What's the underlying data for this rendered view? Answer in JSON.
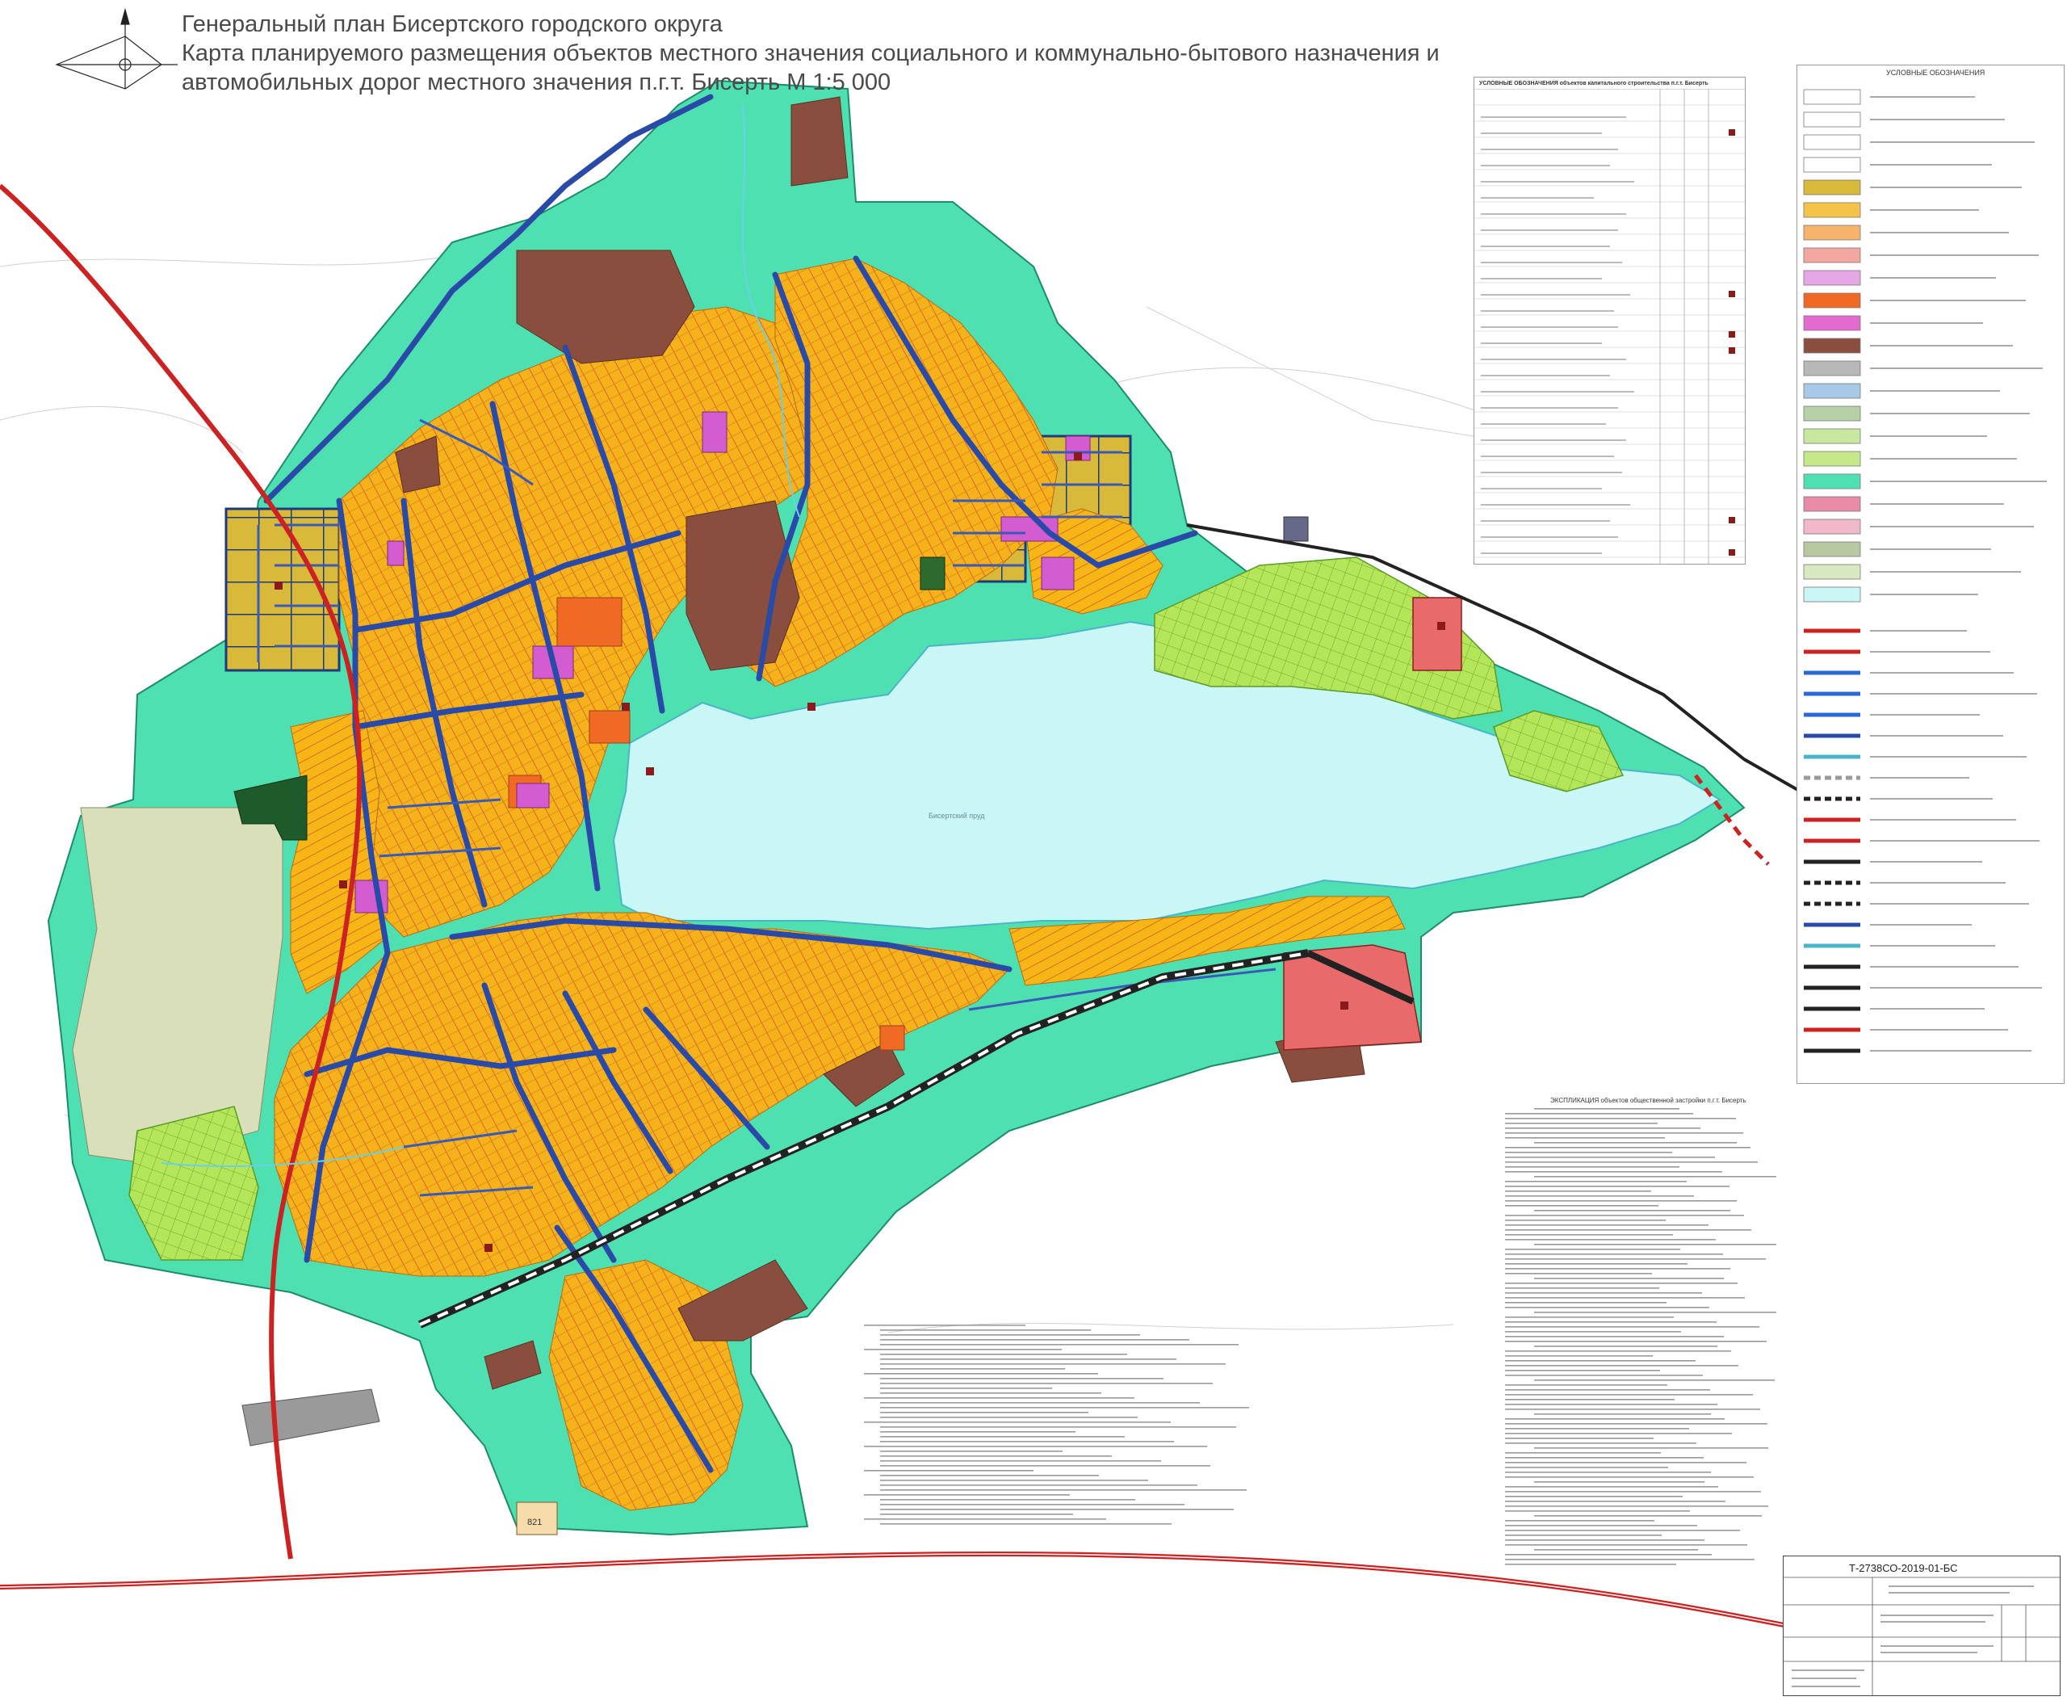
{
  "title": {
    "line1": "Генеральный план Бисертского городского округа",
    "line2": "Карта планируемого размещения объектов местного значения социального и коммунально-бытового назначения и",
    "line3": "автомобильных дорог местного значения п.г.т. Бисерть М 1:5 000"
  },
  "map": {
    "scale": "М 1:5 000",
    "water_label": "Бисертский пруд",
    "plot_label": "821"
  },
  "legend_table": {
    "heading": "УСЛОВНЫЕ ОБОЗНАЧЕНИЯ объектов капитального строительства п.г.т. Бисерть"
  },
  "legend_right": {
    "heading": "УСЛОВНЫЕ ОБОЗНАЧЕНИЯ"
  },
  "explication": {
    "heading": "ЭКСПЛИКАЦИЯ объектов общественной застройки п.г.т. Бисерть"
  },
  "stamp": {
    "code": "Т-2738СО-2019-01-БС"
  },
  "colors": {
    "residential_low": "#d8b93a",
    "residential_ind": "#f5b21a",
    "public": "#d35cd0",
    "business": "#f06a24",
    "production": "#8a4e3e",
    "water": "#c8f7f6",
    "green": "#4fe0b2",
    "agri": "#b5e65a",
    "forest": "#1f5a2a",
    "road_federal": "#cc2222",
    "road_local": "#2a4aa8",
    "special": "#e86a6a"
  },
  "icons": {
    "compass": "compass-rose-icon"
  }
}
